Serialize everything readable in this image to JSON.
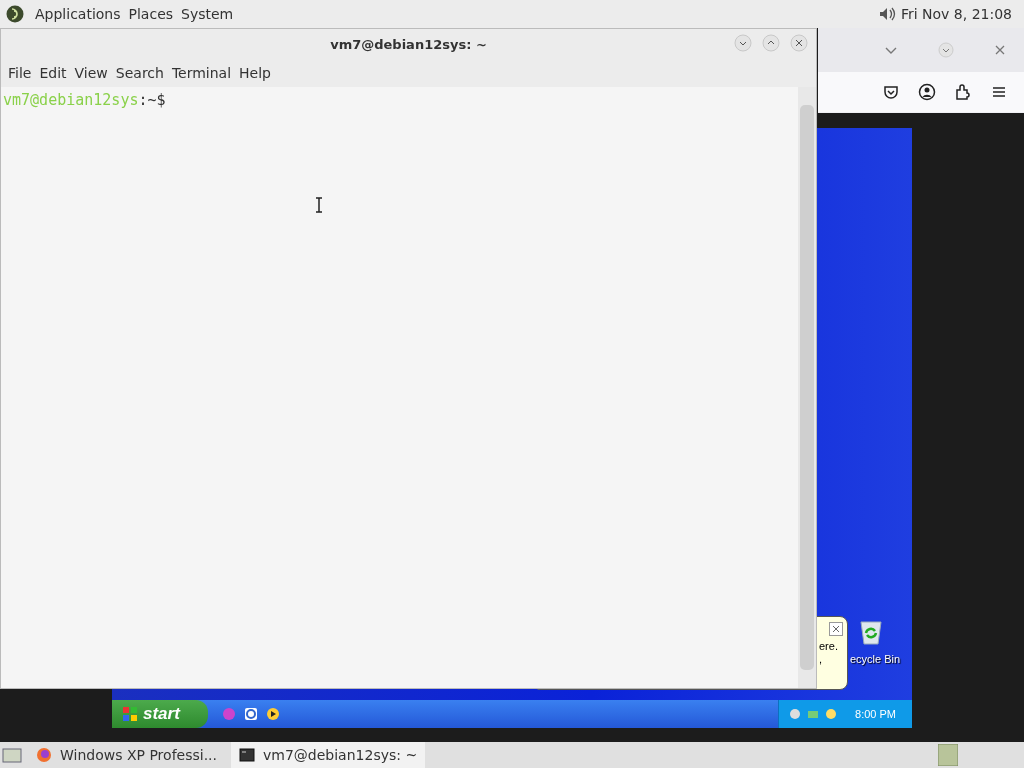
{
  "top_panel": {
    "menus": [
      "Applications",
      "Places",
      "System"
    ],
    "clock": "Fri Nov 8, 21:08"
  },
  "terminal": {
    "title": "vm7@debian12sys: ~",
    "menu": [
      "File",
      "Edit",
      "View",
      "Search",
      "Terminal",
      "Help"
    ],
    "prompt_user": "vm7@debian12sys",
    "prompt_path": ":~$"
  },
  "vm_screen": {
    "desktop_icon": "ecycle Bin",
    "balloon_lines": [
      "ere.",
      ","
    ],
    "start_label": "start",
    "clock": "8:00 PM"
  },
  "taskbar": {
    "items": [
      {
        "label": "Windows XP Professi...",
        "kind": "browser",
        "selected": false
      },
      {
        "label": "vm7@debian12sys: ~",
        "kind": "terminal",
        "selected": true
      }
    ]
  }
}
